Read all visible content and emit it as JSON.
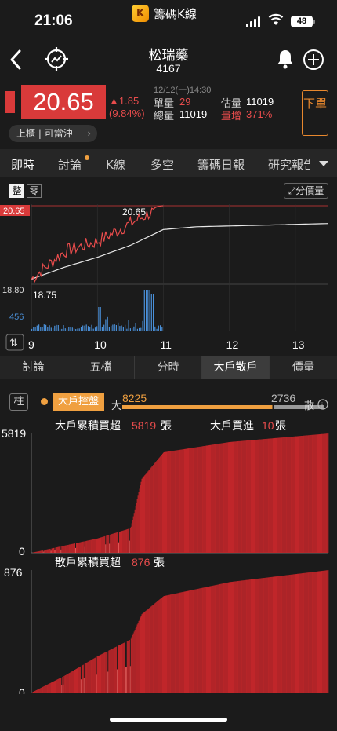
{
  "status": {
    "time": "21:06",
    "battery": "48"
  },
  "app": {
    "logo": "K",
    "name": "籌碼K線"
  },
  "stock": {
    "name": "松瑞藥",
    "code": "4167"
  },
  "quote": {
    "price": "20.65",
    "change": "▲1.85",
    "change_pct": "(9.84%)",
    "datetime": "12/12(一)14:30",
    "single_vol_label": "單量",
    "single_vol": "29",
    "total_vol_label": "總量",
    "total_vol": "11019",
    "est_vol_label": "估量",
    "est_vol": "11019",
    "vol_inc_label": "量增",
    "vol_inc": "371%",
    "market": "上櫃 | 可當沖",
    "sell_label": "下單"
  },
  "tabs": [
    "即時",
    "討論",
    "K線",
    "多空",
    "籌碼日報",
    "研究報告"
  ],
  "intraday": {
    "mode_whole": "整",
    "mode_odd": "零",
    "split_label": "分價量",
    "price_high": "20.65",
    "price_low": "18.80",
    "price_label_line": "20.65",
    "price_label_low": "18.75",
    "vol_label": "456",
    "hours": [
      "9",
      "10",
      "11",
      "12",
      "13"
    ]
  },
  "subtabs": [
    "討論",
    "五檔",
    "分時",
    "大戶散戶",
    "價量"
  ],
  "control": {
    "bar_label": "柱",
    "badge": "大戶控盤",
    "big_label": "大",
    "big_value": "8225",
    "small_label": "散",
    "small_value": "2736",
    "big_ratio": 0.75
  },
  "big_chart": {
    "title_a": "大戶累積買超",
    "value_a": "5819",
    "unit_a": "張",
    "title_b": "大戶買進",
    "value_b": "10",
    "unit_b": "張",
    "ymax_label": "5819",
    "ymin_label": "0"
  },
  "small_chart": {
    "title": "散戶累積買超",
    "value": "876",
    "unit": "張",
    "ymax_label": "876",
    "ymin_label": "0"
  },
  "chart_data": [
    {
      "type": "line",
      "title": "",
      "x": [
        "09:00",
        "09:30",
        "10:00",
        "10:30",
        "11:00",
        "11:30",
        "13:30"
      ],
      "series": [
        {
          "values": [
            18.8,
            19.5,
            19.75,
            20.2,
            20.65,
            20.65,
            20.65
          ]
        },
        {
          "values": [
            18.8,
            19.1,
            19.35,
            19.65,
            20.05,
            20.12,
            20.2
          ]
        }
      ],
      "ylim": [
        18.75,
        20.65
      ],
      "color": "#e84c4c"
    },
    {
      "type": "area",
      "title": "大戶累積買超",
      "x": [
        "09:00",
        "09:30",
        "10:00",
        "10:30",
        "10:40",
        "11:00",
        "12:00",
        "13:30"
      ],
      "values": [
        0,
        350,
        700,
        1200,
        3600,
        4900,
        5400,
        5819
      ],
      "ylim": [
        0,
        5819
      ],
      "color": "#c0262a"
    },
    {
      "type": "area",
      "title": "散戶累積買超",
      "x": [
        "09:00",
        "09:30",
        "10:00",
        "10:30",
        "10:40",
        "11:00",
        "12:00",
        "13:30"
      ],
      "values": [
        0,
        120,
        260,
        380,
        560,
        690,
        790,
        876
      ],
      "ylim": [
        0,
        876
      ],
      "color": "#c0262a"
    }
  ]
}
